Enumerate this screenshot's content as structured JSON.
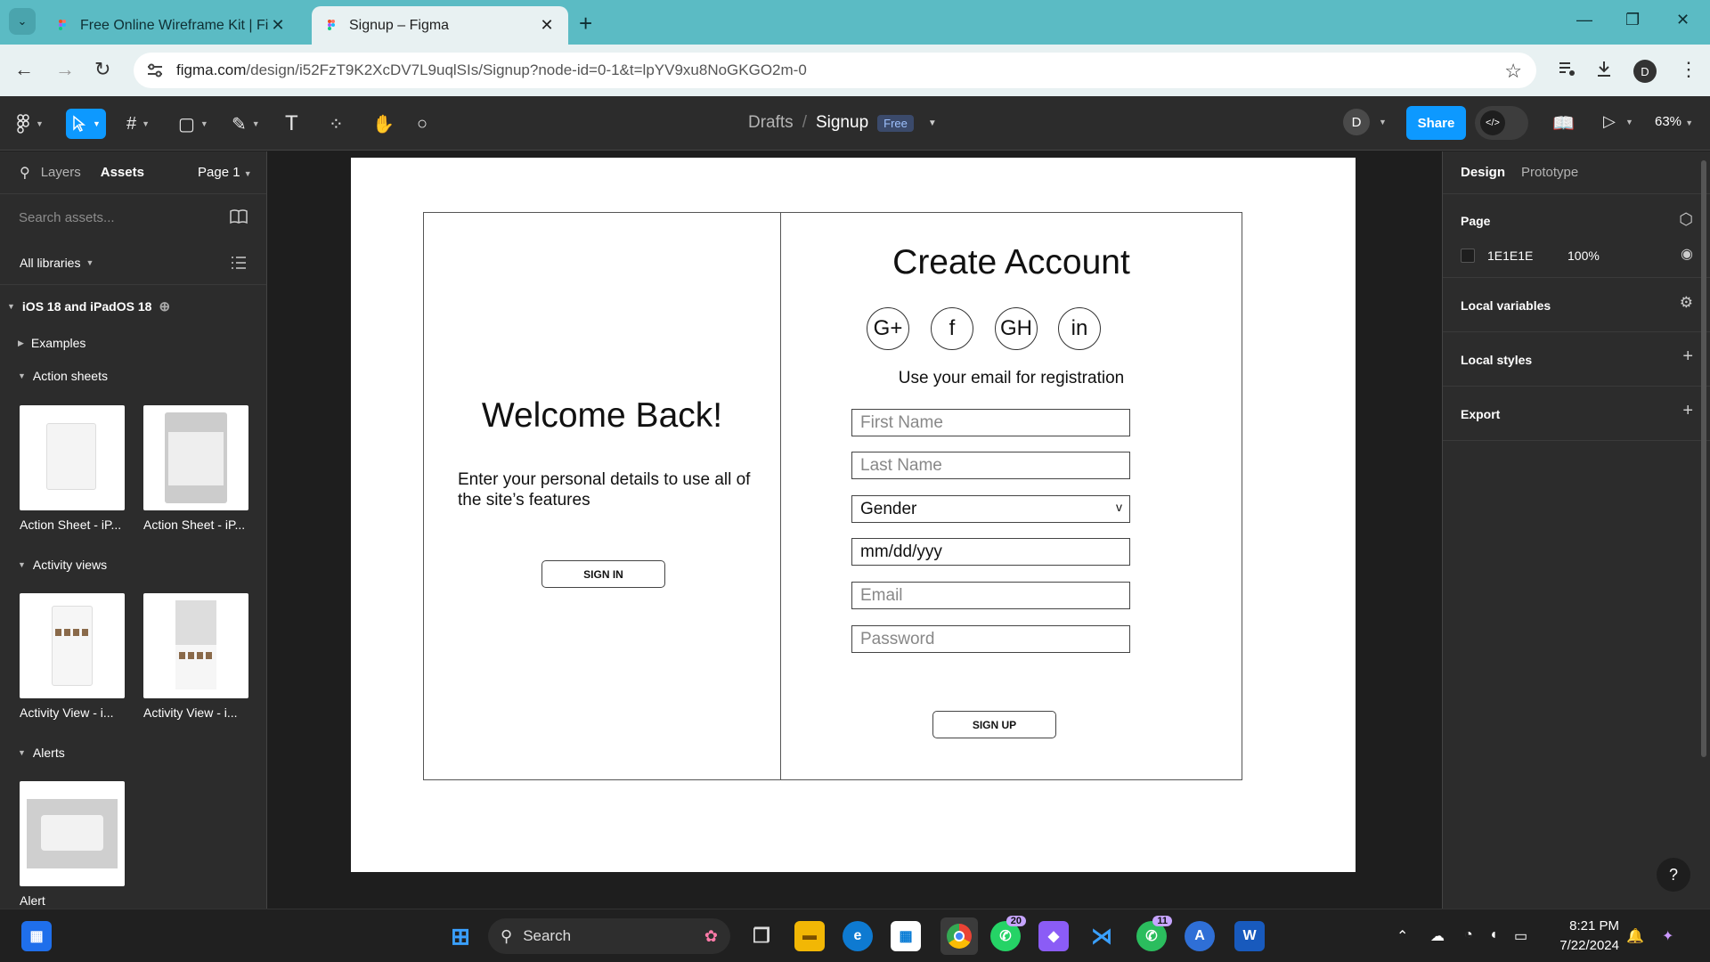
{
  "browser": {
    "tabs": [
      {
        "title": "Free Online Wireframe Kit | Figma",
        "active": false
      },
      {
        "title": "Signup – Figma",
        "active": true
      }
    ],
    "url_host": "figma.com",
    "url_path": "/design/i52FzT9K2XcDV7L9uqlSIs/Signup?node-id=0-1&t=lpYV9xu8NoGKGO2m-0",
    "profile_initial": "D"
  },
  "figma_header": {
    "breadcrumb_parent": "Drafts",
    "file_name": "Signup",
    "plan_badge": "Free",
    "avatar_initial": "D",
    "share_label": "Share",
    "zoom_level": "63%"
  },
  "left_panel": {
    "tab_layers": "Layers",
    "tab_assets": "Assets",
    "page_selector": "Page 1",
    "search_placeholder": "Search assets...",
    "libraries_label": "All libraries",
    "library_name": "iOS 18 and iPadOS 18",
    "groups": {
      "examples": "Examples",
      "action_sheets": "Action sheets",
      "activity_views": "Activity views",
      "alerts": "Alerts"
    },
    "assets": {
      "action_sheet_1": "Action Sheet - iP...",
      "action_sheet_2": "Action Sheet - iP...",
      "activity_view_1": "Activity View - i...",
      "activity_view_2": "Activity View - i...",
      "alert": "Alert"
    }
  },
  "wireframe": {
    "welcome_title": "Welcome Back!",
    "welcome_text": "Enter your personal details to use all of the site’s features",
    "sign_in_button": "SIGN IN",
    "create_title": "Create Account",
    "social_buttons": [
      "G+",
      "f",
      "GH",
      "in"
    ],
    "email_hint": "Use your email for registration",
    "fields": {
      "first_name": "First Name",
      "last_name": "Last Name",
      "gender": "Gender",
      "gender_caret": "v",
      "date": "mm/dd/yyy",
      "email": "Email",
      "password": "Password"
    },
    "sign_up_button": "SIGN UP"
  },
  "right_panel": {
    "tab_design": "Design",
    "tab_prototype": "Prototype",
    "page_heading": "Page",
    "page_color_hex": "1E1E1E",
    "page_opacity": "100%",
    "local_variables": "Local variables",
    "local_styles": "Local styles",
    "export": "Export",
    "help": "?"
  },
  "taskbar": {
    "search_label": "Search",
    "whatsapp_badge": "20",
    "whatsapp2_badge": "11",
    "time": "8:21 PM",
    "date": "7/22/2024"
  },
  "colors": {
    "tabstrip": "#5bbbc4",
    "figma_accent": "#0d99ff",
    "canvas_bg": "#1e1e1e"
  }
}
